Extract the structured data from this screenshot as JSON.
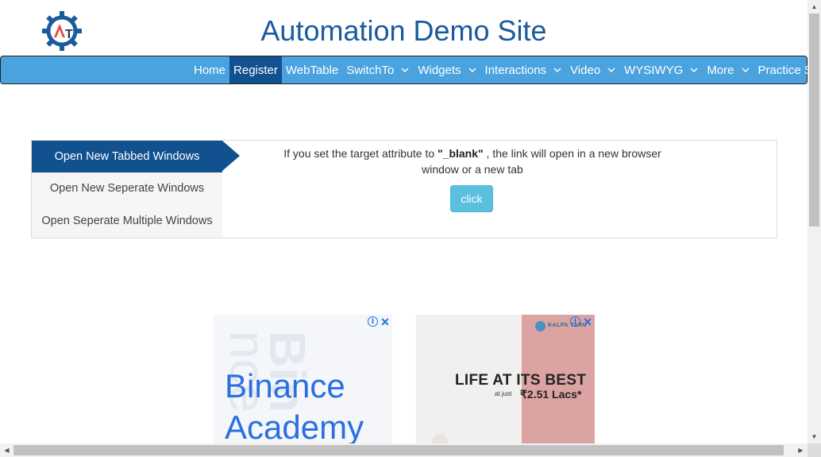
{
  "header": {
    "title": "Automation Demo Site",
    "logo_icon": "automation-testing-gear-logo",
    "logo_text": "AT"
  },
  "nav": {
    "items": [
      {
        "label": "Home",
        "dropdown": false,
        "active": false
      },
      {
        "label": "Register",
        "dropdown": false,
        "active": true
      },
      {
        "label": "WebTable",
        "dropdown": false,
        "active": false
      },
      {
        "label": "SwitchTo",
        "dropdown": true,
        "active": false
      },
      {
        "label": "Widgets",
        "dropdown": true,
        "active": false
      },
      {
        "label": "Interactions",
        "dropdown": true,
        "active": false
      },
      {
        "label": "Video",
        "dropdown": true,
        "active": false
      },
      {
        "label": "WYSIWYG",
        "dropdown": true,
        "active": false
      },
      {
        "label": "More",
        "dropdown": true,
        "active": false
      },
      {
        "label": "Practice Site",
        "dropdown": false,
        "active": false
      }
    ]
  },
  "tabs": {
    "items": [
      {
        "label": "Open New Tabbed Windows",
        "active": true
      },
      {
        "label": "Open New Seperate Windows",
        "active": false
      },
      {
        "label": "Open Seperate Multiple Windows",
        "active": false
      }
    ],
    "content": {
      "text_before": "If you set the target attribute to ",
      "text_bold": "\"_blank\"",
      "text_after": " , the link will open in a new browser window or a new tab",
      "button_label": "click"
    }
  },
  "ads": {
    "ad1": {
      "line1": "Binance",
      "line2": "Academy",
      "bg_text1": "Bin",
      "bg_text2": "nce"
    },
    "ad2": {
      "brand": "KALPA TARU",
      "headline": "LIFE AT ITS BEST",
      "sub": "at just",
      "price": "₹2.51 Lacs*"
    }
  },
  "colors": {
    "nav_bg": "#4aa3df",
    "nav_active": "#11518f",
    "title": "#1a5a9e",
    "button": "#5bc0de"
  }
}
